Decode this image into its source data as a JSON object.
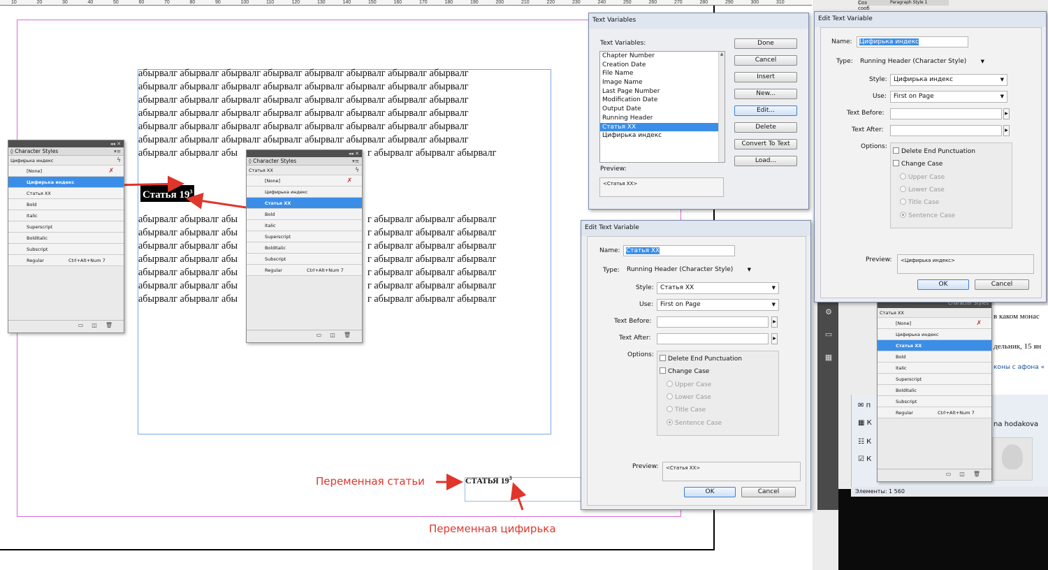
{
  "ruler": {
    "ticks": [
      "10",
      "20",
      "30",
      "40",
      "50",
      "60",
      "70",
      "80",
      "90",
      "100",
      "110",
      "120",
      "130",
      "140",
      "150",
      "160",
      "170",
      "180",
      "190",
      "200",
      "210",
      "220",
      "230",
      "240",
      "250",
      "260",
      "270",
      "280",
      "290",
      "300",
      "310"
    ]
  },
  "document": {
    "body_line": "абырвалг абырвалг абырвалг абырвалг абырвалг абырвалг абырвалг абырвалг",
    "body_line_partial_left": "абырвалг абырвалг абы",
    "body_line_partial_right": "г абырвалг абырвалг абырвалг",
    "heading": {
      "text": "Статья 19",
      "superscript": "3"
    },
    "footer_variable": {
      "text": "СТАТЬЯ 19",
      "superscript": "3"
    },
    "annotation_article": "Переменная статьи",
    "annotation_digit": "Переменная цифирька"
  },
  "char_styles_panel_1": {
    "tab": "◊ Character Styles",
    "current_style": "Цифирька индекс",
    "styles": [
      {
        "name": "[None]",
        "shortcut": ""
      },
      {
        "name": "Цифирька индекс",
        "shortcut": ""
      },
      {
        "name": "Статья XX",
        "shortcut": ""
      },
      {
        "name": "Bold",
        "shortcut": ""
      },
      {
        "name": "Italic",
        "shortcut": ""
      },
      {
        "name": "Superscript",
        "shortcut": ""
      },
      {
        "name": "BoldItalic",
        "shortcut": ""
      },
      {
        "name": "Subscript",
        "shortcut": ""
      },
      {
        "name": "Regular",
        "shortcut": "Ctrl+Alt+Num 7"
      }
    ],
    "selected_index": 1
  },
  "char_styles_panel_2": {
    "tab": "◊ Character Styles",
    "current_style": "Статья XX",
    "styles": [
      {
        "name": "[None]",
        "shortcut": ""
      },
      {
        "name": "Цифирька индекс",
        "shortcut": ""
      },
      {
        "name": "Статья XX",
        "shortcut": ""
      },
      {
        "name": "Bold",
        "shortcut": ""
      },
      {
        "name": "Italic",
        "shortcut": ""
      },
      {
        "name": "Superscript",
        "shortcut": ""
      },
      {
        "name": "BoldItalic",
        "shortcut": ""
      },
      {
        "name": "Subscript",
        "shortcut": ""
      },
      {
        "name": "Regular",
        "shortcut": "Ctrl+Alt+Num 7"
      }
    ],
    "selected_index": 2
  },
  "char_styles_panel_3": {
    "tab": "Character Styles",
    "current_style": "Статья XX",
    "styles": [
      {
        "name": "[None]",
        "shortcut": ""
      },
      {
        "name": "Цифирька индекс",
        "shortcut": ""
      },
      {
        "name": "Статья XX",
        "shortcut": ""
      },
      {
        "name": "Bold",
        "shortcut": ""
      },
      {
        "name": "Italic",
        "shortcut": ""
      },
      {
        "name": "Superscript",
        "shortcut": ""
      },
      {
        "name": "BoldItalic",
        "shortcut": ""
      },
      {
        "name": "Subscript",
        "shortcut": ""
      },
      {
        "name": "Regular",
        "shortcut": "Ctrl+Alt+Num 7"
      }
    ],
    "selected_index": 2
  },
  "text_variables_dialog": {
    "title": "Text Variables",
    "list_label": "Text Variables:",
    "variables": [
      "Chapter Number",
      "Creation Date",
      "File Name",
      "Image Name",
      "Last Page Number",
      "Modification Date",
      "Output Date",
      "Running Header",
      "Статья XX",
      "Цифирька индекс"
    ],
    "selected_index": 8,
    "preview_label": "Preview:",
    "preview_value": "<Статья XX>",
    "buttons": {
      "done": "Done",
      "cancel": "Cancel",
      "insert": "Insert",
      "new": "New...",
      "edit": "Edit...",
      "delete": "Delete",
      "convert": "Convert To Text",
      "load": "Load..."
    }
  },
  "edit_var_1": {
    "title": "Edit Text Variable",
    "name_label": "Name:",
    "name_value": "Цифирька индекс",
    "type_label": "Type:",
    "type_value": "Running Header (Character Style)",
    "style_label": "Style:",
    "style_value": "Цифирька индекс",
    "use_label": "Use:",
    "use_value": "First on Page",
    "before_label": "Text Before:",
    "after_label": "Text After:",
    "options_label": "Options:",
    "opt_delete_punct": "Delete End Punctuation",
    "opt_change_case": "Change Case",
    "opt_upper": "Upper Case",
    "opt_lower": "Lower Case",
    "opt_title": "Title Case",
    "opt_sentence": "Sentence Case",
    "preview_label": "Preview:",
    "preview_value": "<Цифирька индекс>",
    "ok": "OK",
    "cancel": "Cancel"
  },
  "edit_var_2": {
    "title": "Edit Text Variable",
    "name_label": "Name:",
    "name_value": "Статья XX",
    "type_label": "Type:",
    "type_value": "Running Header (Character Style)",
    "style_label": "Style:",
    "style_value": "Статья XX",
    "use_label": "Use:",
    "use_value": "First on Page",
    "before_label": "Text Before:",
    "after_label": "Text After:",
    "options_label": "Options:",
    "opt_delete_punct": "Delete End Punctuation",
    "opt_change_case": "Change Case",
    "opt_upper": "Upper Case",
    "opt_lower": "Lower Case",
    "opt_title": "Title Case",
    "opt_sentence": "Sentence Case",
    "preview_label": "Preview:",
    "preview_value": "<Статья XX>",
    "ok": "OK",
    "cancel": "Cancel"
  },
  "right_area": {
    "top_tab_1": "Paragraph Style 1",
    "top_tab_2": "Соз",
    "top_tab_3": "сооб",
    "doc_line_1": "в каком монас",
    "doc_line_2": "дельник, 15 ян",
    "doc_line_3": "коны с афона «",
    "mail_letter_1": "п",
    "mail_letter_2": "К",
    "mail_letter_3": "К",
    "mail_letter_4": "К",
    "contact": "na hodakova",
    "status": "Элементы: 1 560",
    "panel_header": "Character Styles"
  },
  "colors": {
    "accent": "#3b8ee8",
    "annotation": "#e0352b",
    "margin_guide": "#d86ad8",
    "frame": "#7aa7e0"
  },
  "icons": [
    "chevron-down-icon",
    "lightning-icon",
    "clear-overrides-icon",
    "new-style-icon",
    "delete-icon",
    "panel-menu-icon",
    "arrow-right-icon",
    "collapse-icon"
  ]
}
